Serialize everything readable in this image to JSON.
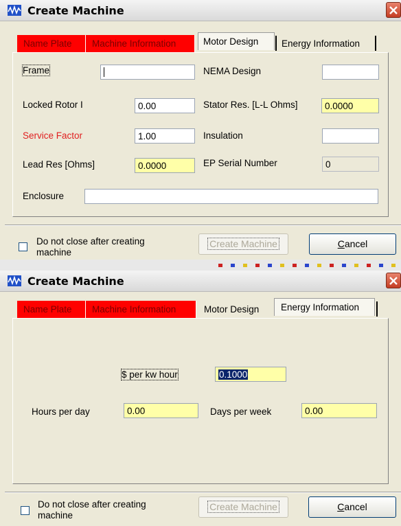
{
  "dialog1": {
    "title": "Create Machine",
    "tabs": {
      "name_plate": "Name Plate",
      "machine_information": "Machine Information",
      "motor_design": "Motor Design",
      "energy_information": "Energy Information"
    },
    "fields": {
      "frame": {
        "label": "Frame",
        "value": ""
      },
      "nema_design": {
        "label": "NEMA Design",
        "value": ""
      },
      "locked_rotor": {
        "label": "Locked Rotor I",
        "value": "0.00"
      },
      "stator_res": {
        "label": "Stator Res. [L-L Ohms]",
        "value": "0.0000"
      },
      "service_factor": {
        "label": "Service Factor",
        "value": "1.00"
      },
      "insulation": {
        "label": "Insulation",
        "value": ""
      },
      "lead_res": {
        "label": "Lead Res [Ohms]",
        "value": "0.0000"
      },
      "ep_serial": {
        "label": "EP Serial Number",
        "value": "0"
      },
      "enclosure": {
        "label": "Enclosure",
        "value": ""
      }
    },
    "checkbox": {
      "label_line1": "Do not close after creating",
      "label_line2": "machine",
      "checked": false
    },
    "create_button": "Create Machine",
    "cancel_button": {
      "underlined": "C",
      "rest": "ancel"
    }
  },
  "dialog2": {
    "title": "Create Machine",
    "tabs": {
      "name_plate": "Name Plate",
      "machine_information": "Machine Information",
      "motor_design": "Motor Design",
      "energy_information": "Energy Information"
    },
    "fields": {
      "per_kw_hour": {
        "label": "$ per kw hour",
        "value": "0.1000"
      },
      "hours_per_day": {
        "label": "Hours per day",
        "value": "0.00"
      },
      "days_per_week": {
        "label": "Days per week",
        "value": "0.00"
      }
    },
    "checkbox": {
      "label_line1": "Do not close after creating",
      "label_line2": "machine",
      "checked": false
    },
    "create_button": "Create Machine",
    "cancel_button": {
      "underlined": "C",
      "rest": "ancel"
    }
  },
  "colors": {
    "required_tab": "#ff0000",
    "yellow_field": "#ffffa8",
    "dialog_bg": "#ece9d8"
  }
}
